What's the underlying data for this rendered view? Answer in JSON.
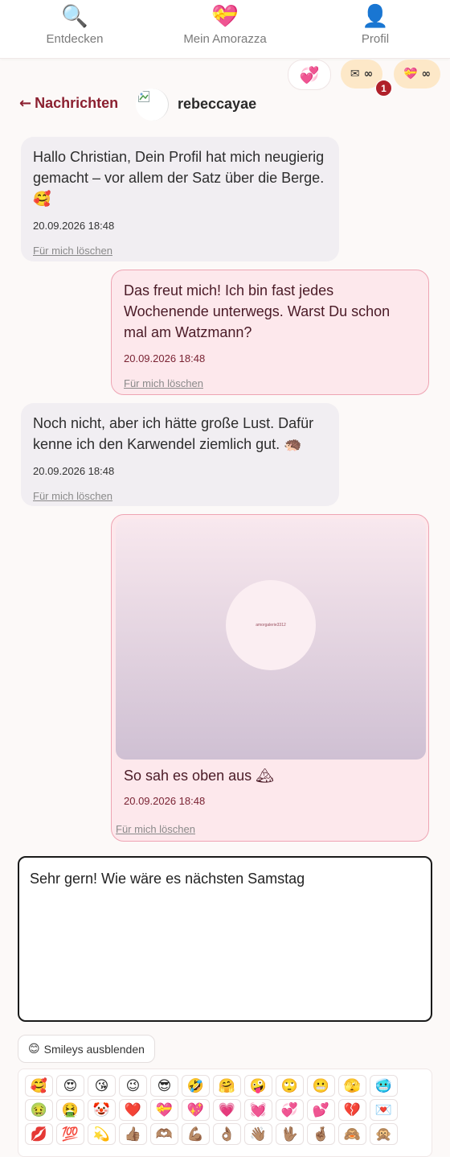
{
  "nav": {
    "items": [
      {
        "icon": "🔍",
        "label": "Entdecken"
      },
      {
        "icon": "💝",
        "label": "Mein Amorazza"
      },
      {
        "icon": "👤",
        "label": "Profil"
      }
    ]
  },
  "chips": {
    "hearts_icon": "💞",
    "mail_icon": "✉",
    "mail_count": "∞",
    "mail_badge": "1",
    "gift_icon": "💝",
    "gift_count": "∞"
  },
  "header": {
    "back_arrow": "←",
    "back_label": "Nachrichten",
    "username": "rebeccayae"
  },
  "messages": [
    {
      "direction": "in",
      "text": "Hallo Christian, Dein Profil hat mich neugierig gemacht – vor allem der Satz über die Berge.",
      "emoji": "🥰",
      "time": "20.09.2026 18:48",
      "delete_label": "Für mich löschen"
    },
    {
      "direction": "out",
      "text": "Das freut mich! Ich bin fast jedes Wochenende unterwegs. Warst Du schon mal am Watzmann?",
      "time": "20.09.2026 18:48",
      "delete_label": "Für mich löschen"
    },
    {
      "direction": "in",
      "text": "Noch nicht, aber ich hätte große Lust. Dafür kenne ich den Karwendel ziemlich gut.",
      "emoji": "🦔",
      "time": "20.09.2026 18:48",
      "delete_label": "Für mich löschen"
    },
    {
      "direction": "out",
      "type": "image",
      "image_text": "amorgalerie3312",
      "caption": "So sah es oben aus",
      "emoji": "🏔",
      "time": "20.09.2026 18:48",
      "delete_label": "Für mich löschen"
    }
  ],
  "composer": {
    "value": "Sehr gern! Wie wäre es nächsten Samstag"
  },
  "smileys": {
    "toggle_icon": "😊",
    "toggle_label": "Smileys ausblenden",
    "rows": [
      [
        "🥰",
        "😍",
        "😘",
        "😉",
        "😎",
        "🤣",
        "🤗",
        "🤪",
        "🙄",
        "😬",
        "🫣",
        "🥶"
      ],
      [
        "🤢",
        "🤮",
        "🤡",
        "❤️",
        "💝",
        "💖",
        "💗",
        "💓",
        "💞",
        "💕",
        "💔",
        "💌"
      ],
      [
        "💋",
        "💯",
        "💫",
        "👍🏽",
        "🫶🏽",
        "💪🏽",
        "👌🏽",
        "👋🏽",
        "🖖🏽",
        "🤞🏽",
        "🙈",
        "🙊"
      ]
    ]
  }
}
